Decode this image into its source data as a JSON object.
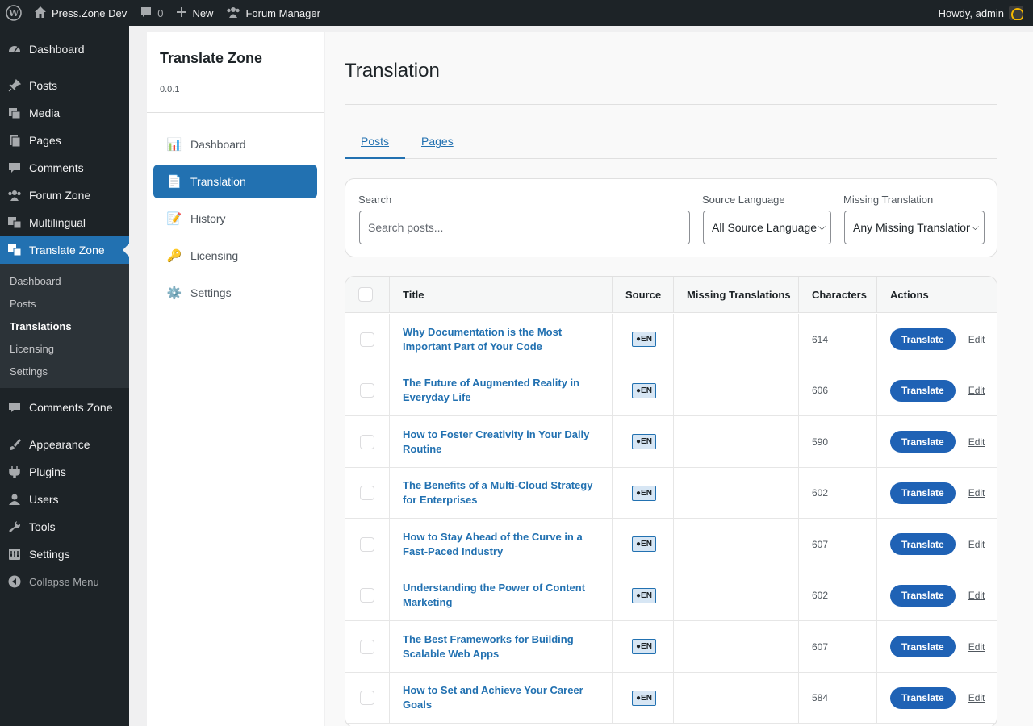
{
  "admin_bar": {
    "site_name": "Press.Zone Dev",
    "comments_count": "0",
    "new_label": "New",
    "forum_label": "Forum Manager",
    "howdy": "Howdy, admin"
  },
  "admin_menu": {
    "items": [
      {
        "label": "Dashboard",
        "icon": "dashboard-icon"
      },
      {
        "label": "Posts",
        "icon": "pin-icon"
      },
      {
        "label": "Media",
        "icon": "media-icon"
      },
      {
        "label": "Pages",
        "icon": "pages-icon"
      },
      {
        "label": "Comments",
        "icon": "comment-icon"
      },
      {
        "label": "Forum Zone",
        "icon": "groups-icon"
      },
      {
        "label": "Multilingual",
        "icon": "translation-icon"
      },
      {
        "label": "Translate Zone",
        "icon": "translation-icon"
      }
    ],
    "submenu": [
      "Dashboard",
      "Posts",
      "Translations",
      "Licensing",
      "Settings"
    ],
    "items_after": [
      {
        "label": "Comments Zone",
        "icon": "comment-icon"
      },
      {
        "label": "Appearance",
        "icon": "brush-icon"
      },
      {
        "label": "Plugins",
        "icon": "plugin-icon"
      },
      {
        "label": "Users",
        "icon": "user-icon"
      },
      {
        "label": "Tools",
        "icon": "wrench-icon"
      },
      {
        "label": "Settings",
        "icon": "settings-icon"
      }
    ],
    "collapse_label": "Collapse Menu"
  },
  "plugin_sidebar": {
    "title": "Translate Zone",
    "version": "0.0.1",
    "nav": [
      {
        "label": "Dashboard",
        "emoji": "📊"
      },
      {
        "label": "Translation",
        "emoji": "📄"
      },
      {
        "label": "History",
        "emoji": "📝"
      },
      {
        "label": "Licensing",
        "emoji": "🔑"
      },
      {
        "label": "Settings",
        "emoji": "⚙️"
      }
    ]
  },
  "main": {
    "title": "Translation",
    "tabs": [
      {
        "label": "Posts"
      },
      {
        "label": "Pages"
      }
    ],
    "filters": {
      "search_label": "Search",
      "search_placeholder": "Search posts...",
      "source_label": "Source Language",
      "source_value": "All Source Languages",
      "missing_label": "Missing Translation",
      "missing_value": "Any Missing Translation"
    },
    "table": {
      "headers": {
        "title": "Title",
        "source": "Source",
        "missing": "Missing Translations",
        "characters": "Characters",
        "actions": "Actions"
      },
      "translate_label": "Translate",
      "edit_label": "Edit",
      "rows": [
        {
          "title": "Why Documentation is the Most Important Part of Your Code",
          "source": "EN",
          "missing": "",
          "characters": "614"
        },
        {
          "title": "The Future of Augmented Reality in Everyday Life",
          "source": "EN",
          "missing": "",
          "characters": "606"
        },
        {
          "title": "How to Foster Creativity in Your Daily Routine",
          "source": "EN",
          "missing": "",
          "characters": "590"
        },
        {
          "title": "The Benefits of a Multi-Cloud Strategy for Enterprises",
          "source": "EN",
          "missing": "",
          "characters": "602"
        },
        {
          "title": "How to Stay Ahead of the Curve in a Fast-Paced Industry",
          "source": "EN",
          "missing": "",
          "characters": "607"
        },
        {
          "title": "Understanding the Power of Content Marketing",
          "source": "EN",
          "missing": "",
          "characters": "602"
        },
        {
          "title": "The Best Frameworks for Building Scalable Web Apps",
          "source": "EN",
          "missing": "",
          "characters": "607"
        },
        {
          "title": "How to Set and Achieve Your Career Goals",
          "source": "EN",
          "missing": "",
          "characters": "584"
        }
      ]
    }
  }
}
